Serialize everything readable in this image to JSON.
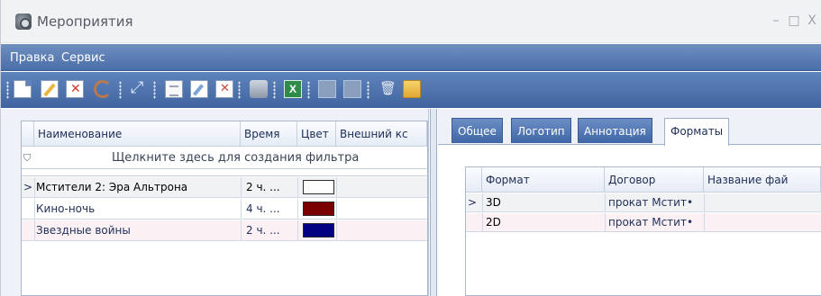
{
  "window": {
    "title": "Мероприятия",
    "minimize_glyph": "–",
    "maximize_glyph": "□",
    "close_glyph": "X"
  },
  "menu": [
    {
      "label": "Правка"
    },
    {
      "label": "Сервис"
    }
  ],
  "toolbar_icons": [
    "new-icon",
    "edit-icon",
    "delete-icon",
    "refresh-icon",
    "move-icon",
    "document-icon",
    "document-edit-icon",
    "document-delete-icon",
    "print-icon",
    "excel-icon",
    "calendar-icon",
    "calendar-settings-icon",
    "trash-icon",
    "folder-icon"
  ],
  "left_grid": {
    "columns": [
      "Наименование",
      "Время",
      "Цвет",
      "Внешний кс"
    ],
    "filter_placeholder": "Щелкните здесь для создания фильтра",
    "rows": [
      {
        "indicator": ">",
        "name": "Мстители 2: Эра Альтрона",
        "time": "2 ч. ...",
        "color": "#ffffff"
      },
      {
        "indicator": "",
        "name": "Кино-ночь",
        "time": "4 ч. ...",
        "color": "#7a0000"
      },
      {
        "indicator": "",
        "name": "Звездные войны",
        "time": "2 ч. ...",
        "color": "#000080"
      }
    ]
  },
  "tabs": [
    {
      "label": "Общее",
      "active": false
    },
    {
      "label": "Логотип",
      "active": false
    },
    {
      "label": "Аннотация",
      "active": false
    },
    {
      "label": "Форматы",
      "active": true
    }
  ],
  "right_grid": {
    "columns": [
      "Формат",
      "Договор",
      "Название фай"
    ],
    "rows": [
      {
        "indicator": ">",
        "format": "3D",
        "contract": "прокат Мстит•",
        "file": ""
      },
      {
        "indicator": "",
        "format": "2D",
        "contract": "прокат Мстит•",
        "file": ""
      }
    ]
  }
}
